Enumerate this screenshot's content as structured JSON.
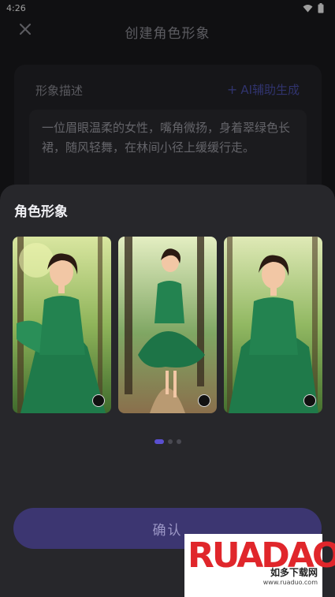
{
  "status_bar": {
    "time": "4:26",
    "icons": [
      "wifi-icon",
      "battery-icon"
    ]
  },
  "header": {
    "title": "创建角色形象",
    "close_icon": "close-icon"
  },
  "description": {
    "label": "形象描述",
    "ai_button": "AI辅助生成",
    "ai_icon": "plus-icon",
    "text": "一位眉眼温柔的女性，嘴角微扬，身着翠绿色长裙，随风轻舞，在林间小径上缓缓行走。"
  },
  "sheet": {
    "title": "角色形象",
    "images": [
      {
        "selected": false
      },
      {
        "selected": false
      },
      {
        "selected": false
      }
    ],
    "page_count": 3,
    "current_page": 1,
    "confirm_label": "确认"
  },
  "watermark": {
    "logo": "RUANDAO",
    "sub": "如多下载网",
    "url": "www.ruaduo.com"
  },
  "colors": {
    "accent": "#5a4fd0",
    "confirm_bg": "#3c3671",
    "sheet_bg": "#27272b",
    "ai_link": "#4a4fa8"
  }
}
